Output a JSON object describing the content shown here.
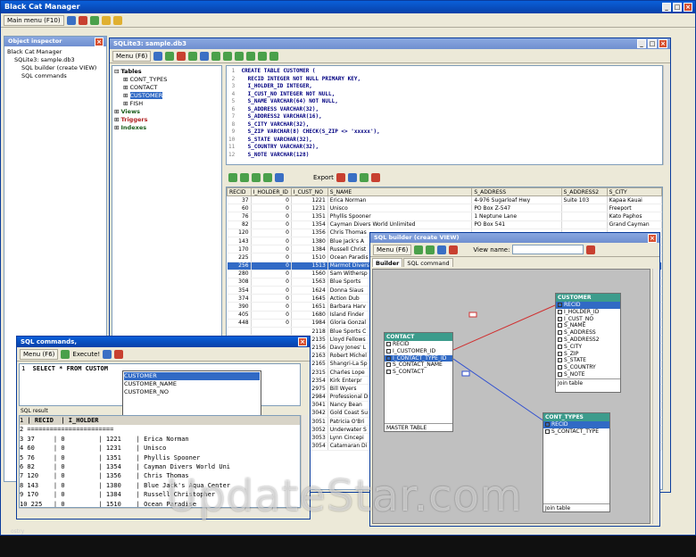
{
  "main_window": {
    "title": "Black Cat Manager",
    "menu_label": "Main menu (F10)"
  },
  "object_inspector": {
    "title": "Object inspector",
    "items": [
      "Black Cat Manager",
      "SQLite3: sample.db3",
      "SQL builder (create VIEW)",
      "SQL commands"
    ]
  },
  "db_window": {
    "title": "SQLite3: sample.db3",
    "menu_label": "Menu (F6)",
    "tree": {
      "tables_label": "Tables",
      "tables": [
        "CONT_TYPES",
        "CONTACT",
        "CUSTOMER",
        "FISH"
      ],
      "views_label": "Views",
      "triggers_label": "Triggers",
      "indexes_label": "Indexes"
    },
    "code_lines": [
      {
        "n": "1",
        "t": "CREATE TABLE CUSTOMER ("
      },
      {
        "n": "2",
        "t": "  RECID INTEGER NOT NULL PRIMARY KEY,"
      },
      {
        "n": "3",
        "t": "  I_HOLDER_ID INTEGER,"
      },
      {
        "n": "4",
        "t": "  I_CUST_NO INTEGER NOT NULL,"
      },
      {
        "n": "5",
        "t": "  S_NAME VARCHAR(64) NOT NULL,"
      },
      {
        "n": "6",
        "t": "  S_ADDRESS VARCHAR(32),"
      },
      {
        "n": "7",
        "t": "  S_ADDRESS2 VARCHAR(16),"
      },
      {
        "n": "8",
        "t": "  S_CITY VARCHAR(32),"
      },
      {
        "n": "9",
        "t": "  S_ZIP VARCHAR(8) CHECK(S_ZIP <> 'xxxxx'),"
      },
      {
        "n": "10",
        "t": "  S_STATE VARCHAR(32),"
      },
      {
        "n": "11",
        "t": "  S_COUNTRY VARCHAR(32),"
      },
      {
        "n": "12",
        "t": "  S_NOTE VARCHAR(128)"
      }
    ],
    "export_label": "Export",
    "grid_columns": [
      "RECID",
      "I_HOLDER_ID",
      "I_CUST_NO",
      "S_NAME",
      "S_ADDRESS",
      "S_ADDRESS2",
      "S_CITY"
    ],
    "grid_rows": [
      [
        "37",
        "0",
        "1221",
        "Erica Norman",
        "4-976 Sugarloaf Hwy",
        "Suite 103",
        "Kapaa Kauai"
      ],
      [
        "60",
        "0",
        "1231",
        "Unisco",
        "PO Box Z-547",
        "",
        "Freeport"
      ],
      [
        "76",
        "0",
        "1351",
        "Phyllis Spooner",
        "1 Neptune Lane",
        "",
        "Kato Paphos"
      ],
      [
        "82",
        "0",
        "1354",
        "Cayman Divers World Unlimited",
        "PO Box 541",
        "",
        "Grand Cayman"
      ],
      [
        "120",
        "0",
        "1356",
        "Chris Thomas",
        "",
        "",
        ""
      ],
      [
        "143",
        "0",
        "1380",
        "Blue Jack's A",
        "",
        "",
        ""
      ],
      [
        "170",
        "0",
        "1384",
        "Russell Christ",
        "",
        "",
        ""
      ],
      [
        "225",
        "0",
        "1510",
        "Ocean Paradis",
        "",
        "",
        ""
      ],
      [
        "256",
        "0",
        "1513",
        "Marmot Divers",
        "",
        "",
        ""
      ],
      [
        "280",
        "0",
        "1560",
        "Sam Withersp",
        "",
        "",
        ""
      ],
      [
        "308",
        "0",
        "1563",
        "Blue Sports",
        "",
        "",
        ""
      ],
      [
        "354",
        "0",
        "1624",
        "Donna Siaus",
        "",
        "",
        ""
      ],
      [
        "374",
        "0",
        "1645",
        "Action Dub",
        "",
        "",
        ""
      ],
      [
        "390",
        "0",
        "1651",
        "Barbara Harv",
        "",
        "",
        ""
      ],
      [
        "405",
        "0",
        "1680",
        "Island Finder",
        "",
        "",
        ""
      ],
      [
        "448",
        "0",
        "1984",
        "Gloria Gonzal",
        "",
        "",
        ""
      ],
      [
        "",
        "",
        "2118",
        "Blue Sports C",
        "",
        "",
        ""
      ],
      [
        "",
        "",
        "2135",
        "Lloyd Fellows",
        "",
        "",
        ""
      ],
      [
        "",
        "",
        "2156",
        "Davy Jones' L",
        "",
        "",
        ""
      ],
      [
        "",
        "",
        "2163",
        "Robert Michel",
        "",
        "",
        ""
      ],
      [
        "",
        "",
        "2165",
        "Shangri-La Sp",
        "",
        "",
        ""
      ],
      [
        "",
        "",
        "2315",
        "Charles Lope",
        "",
        "",
        ""
      ],
      [
        "",
        "",
        "2354",
        "Kirk Enterpr",
        "",
        "",
        ""
      ],
      [
        "",
        "",
        "2975",
        "Bill Wyers",
        "",
        "",
        ""
      ],
      [
        "",
        "",
        "2984",
        "Professional D",
        "",
        "",
        ""
      ],
      [
        "",
        "",
        "3041",
        "Nancy Bean",
        "",
        "",
        ""
      ],
      [
        "",
        "",
        "3042",
        "Gold Coast Su",
        "",
        "",
        ""
      ],
      [
        "",
        "",
        "3051",
        "Patricia O'Bri",
        "",
        "",
        ""
      ],
      [
        "",
        "",
        "3052",
        "Underwater S",
        "",
        "",
        ""
      ],
      [
        "",
        "",
        "3053",
        "Lynn Cincepi",
        "",
        "",
        ""
      ],
      [
        "",
        "",
        "3054",
        "Catamaran Di",
        "",
        "",
        ""
      ]
    ],
    "status_file": "file: D:\\Develop\\S"
  },
  "sql_builder": {
    "title": "SQL builder (create VIEW)",
    "menu_label": "Menu (F6)",
    "view_name_label": "View name:",
    "tab_builder": "Builder",
    "tab_sql": "SQL command",
    "customer_table": {
      "name": "CUSTOMER",
      "fields": [
        "RECID",
        "I_HOLDER_ID",
        "I_CUST_NO",
        "S_NAME",
        "S_ADDRESS",
        "S_ADDRESS2",
        "S_CITY",
        "S_ZIP",
        "S_STATE",
        "S_COUNTRY",
        "S_NOTE"
      ],
      "footer": "Join table"
    },
    "contact_table": {
      "name": "CONTACT",
      "fields": [
        "RECID",
        "I_CUSTOMER_ID",
        "I_CONTACT_TYPE_ID",
        "S_CONTACT_NAME",
        "S_CONTACT"
      ],
      "footer": "MASTER TABLE"
    },
    "cont_types_table": {
      "name": "CONT_TYPES",
      "fields": [
        "RECID",
        "S_CONTACT_TYPE"
      ],
      "footer": "Join table"
    }
  },
  "sql_commands": {
    "title": "SQL commands,",
    "menu_label": "Menu (F6)",
    "execute_label": "Execute!",
    "query_num": "1",
    "query_text": "SELECT * FROM CUSTOM",
    "autocomplete": [
      "CUSTOMER",
      "CUSTOMER_NAME",
      "CUSTOMER_NO"
    ],
    "result_label": "SQL result",
    "result_header": "| RECID  | I_HOLDER",
    "result_lines": [
      "2 =======================",
      "3 37     | 0         | 1221    | Erica Norman",
      "4 60     | 0         | 1231    | Unisco",
      "5 76     | 0         | 1351    | Phyllis Spooner",
      "6 82     | 0         | 1354    | Cayman Divers World Uni",
      "7 120    | 0         | 1356    | Chris Thomas",
      "8 143    | 0         | 1380    | Blue Jack's Aqua Center",
      "9 170    | 0         | 1384    | Russell Christopher",
      "10 225   | 0         | 1510    | Ocean Paradise"
    ]
  },
  "watermark": "UpdateStar.com",
  "desktop_labels": [
    "ostry"
  ]
}
